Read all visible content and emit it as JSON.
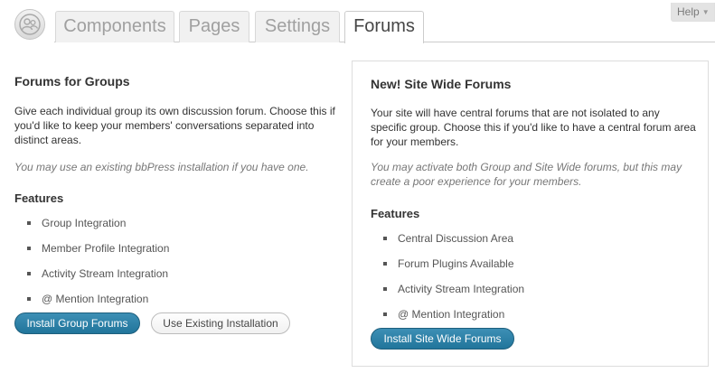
{
  "tabs": [
    {
      "label": "Components"
    },
    {
      "label": "Pages"
    },
    {
      "label": "Settings"
    },
    {
      "label": "Forums"
    }
  ],
  "help": {
    "label": "Help"
  },
  "group_forums": {
    "title": "Forums for Groups",
    "description": "Give each individual group its own discussion forum. Choose this if you'd like to keep your members' conversations separated into distinct areas.",
    "note": "You may use an existing bbPress installation if you have one.",
    "features_heading": "Features",
    "features": [
      "Group Integration",
      "Member Profile Integration",
      "Activity Stream Integration",
      "@ Mention Integration"
    ],
    "install_button": "Install Group Forums",
    "existing_button": "Use Existing Installation"
  },
  "site_forums": {
    "title": "New! Site Wide Forums",
    "description": "Your site will have central forums that are not isolated to any specific group. Choose this if you'd like to have a central forum area for your members.",
    "note": "You may activate both Group and Site Wide forums, but this may create a poor experience for your members.",
    "features_heading": "Features",
    "features": [
      "Central Discussion Area",
      "Forum Plugins Available",
      "Activity Stream Integration",
      "@ Mention Integration"
    ],
    "install_button": "Install Site Wide Forums"
  },
  "colors": {
    "primary_button": "#21759b",
    "tab_active_text": "#464646",
    "tab_inactive_text": "#a0a0a0"
  }
}
